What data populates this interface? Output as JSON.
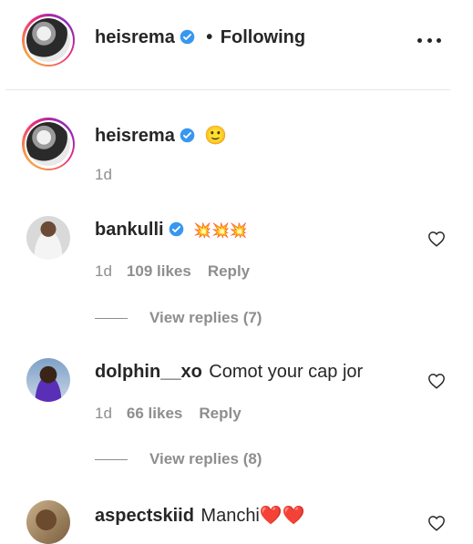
{
  "header": {
    "username": "heisrema",
    "separator": "•",
    "follow_status": "Following"
  },
  "caption": {
    "username": "heisrema",
    "text": "🙂",
    "time": "1d"
  },
  "comments": [
    {
      "username": "bankulli",
      "verified": true,
      "text": "💥💥💥",
      "time": "1d",
      "likes": "109 likes",
      "reply": "Reply",
      "view_replies": "View replies (7)"
    },
    {
      "username": "dolphin__xo",
      "verified": false,
      "text": "Comot your cap jor",
      "time": "1d",
      "likes": "66 likes",
      "reply": "Reply",
      "view_replies": "View replies (8)"
    },
    {
      "username": "aspectskiid",
      "verified": false,
      "text": "Manchi❤️❤️"
    }
  ],
  "colors": {
    "verified_blue": "#3897f0",
    "secondary_text": "#8e8e8e",
    "primary_text": "#262626"
  }
}
